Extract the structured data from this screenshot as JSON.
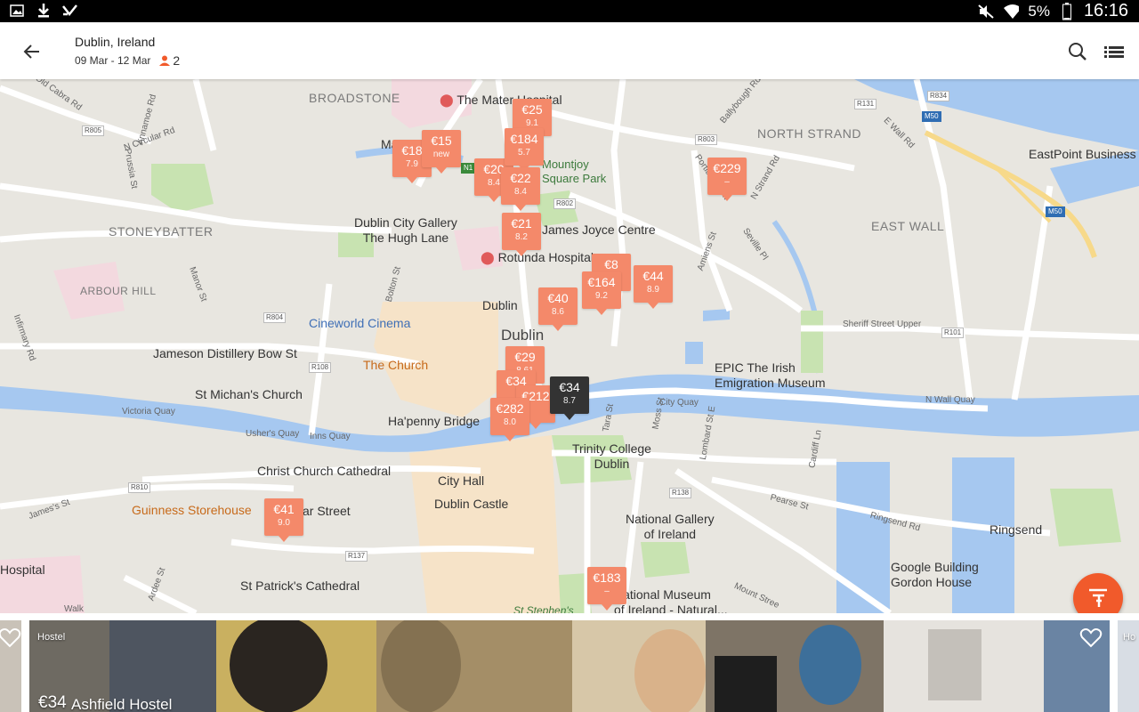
{
  "status": {
    "battery": "5%",
    "time": "16:16"
  },
  "header": {
    "city": "Dublin, Ireland",
    "dates": "09 Mar - 12 Mar",
    "guests": "2"
  },
  "map": {
    "labels": {
      "broadstone": "BROADSTONE",
      "north_strand": "NORTH STRAND",
      "stoneybatter": "STONEYBATTER",
      "east_wall": "EAST WALL",
      "arbour_hill": "ARBOUR HILL",
      "mater_hospital": "The Mater Hospital",
      "mater": "Mater",
      "mountjoy": "Mountjoy\nSquare Park",
      "gallery": "Dublin City Gallery\nThe Hugh Lane",
      "joyce": "James Joyce Centre",
      "rotunda": "Rotunda Hospital",
      "dublin_small": "Dublin",
      "dublin_big": "Dublin",
      "cineworld": "Cineworld Cinema",
      "jameson": "Jameson Distillery Bow St",
      "the_church": "The Church",
      "st_michans": "St Michan's Church",
      "hapenny": "Ha'penny Bridge",
      "epic": "EPIC The Irish\nEmigration Museum",
      "trinity": "Trinity College\nDublin",
      "christ_church": "Christ Church Cathedral",
      "city_hall": "City Hall",
      "dublin_castle": "Dublin Castle",
      "guinness": "Guinness Storehouse",
      "thomas_st": "ar Street",
      "national_gallery": "National Gallery\nof Ireland",
      "st_patricks": "St Patrick's Cathedral",
      "nat_museum": "National Museum\nof Ireland - Natural...",
      "st_stephens": "St Stephen's",
      "google": "Google Building\nGordon House",
      "ringsend": "Ringsend",
      "eastpoint": "EastPoint Business",
      "hospital": "Hospital",
      "sheriff": "Sheriff Street Upper",
      "north_wall": "N Wall Quay",
      "city_quay": "City Quay",
      "victoria_quay": "Victoria Quay",
      "ushers_quay": "Usher's Quay",
      "inns_quay": "Inns Quay",
      "old_cabra": "Old Cabra Rd",
      "n_circular": "N Circular Rd",
      "ballybough": "Ballybough Rd",
      "portland": "Portland Row",
      "n_strand_rd": "N Strand Rd",
      "amiens": "Amiens St",
      "seville": "Seville Pl",
      "e_wall_rd": "E Wall Rd",
      "bolton": "Bolton St",
      "manor": "Manor St",
      "infirmary": "Infirmary Rd",
      "prussia": "Prussia St",
      "annamoe": "Annamoe Rd",
      "tara": "Tara St",
      "moss": "Moss St",
      "lombard": "Lombard St E",
      "cardiff": "Cardiff Ln",
      "pearse": "Pearse St",
      "ringsend_rd": "Ringsend Rd",
      "mount_st": "Mount Stree",
      "james_st": "James's St",
      "cork_st": "Walk",
      "ardee": "Ardee St",
      "r_805": "R805",
      "r_803": "R803",
      "r_131": "R131",
      "r_834": "R834",
      "r_802": "R802",
      "r_804": "R804",
      "r_108": "R108",
      "r_101": "R101",
      "r_810": "R810",
      "r_138": "R138",
      "r_137": "R137",
      "m_50a": "M50",
      "m_50b": "M50",
      "n_1": "N1"
    },
    "pins": [
      {
        "price": "€25",
        "rating": "9.1"
      },
      {
        "price": "€18",
        "rating": "7.9"
      },
      {
        "price": "€15",
        "rating": "new"
      },
      {
        "price": "€184",
        "rating": "5.7"
      },
      {
        "price": "€20",
        "rating": "8.4"
      },
      {
        "price": "€22",
        "rating": "8.4"
      },
      {
        "price": "€229",
        "rating": "–"
      },
      {
        "price": "€21",
        "rating": "8.2"
      },
      {
        "price": "€8",
        "rating": ""
      },
      {
        "price": "€164",
        "rating": "9.2"
      },
      {
        "price": "€44",
        "rating": "8.9"
      },
      {
        "price": "€40",
        "rating": "8.6"
      },
      {
        "price": "€29",
        "rating": "8.61"
      },
      {
        "price": "€34",
        "rating": ""
      },
      {
        "price": "€212",
        "rating": ""
      },
      {
        "price": "€282",
        "rating": "8.0"
      },
      {
        "price": "€34",
        "rating": "8.7"
      },
      {
        "price": "€41",
        "rating": "9.0"
      },
      {
        "price": "€183",
        "rating": "–"
      }
    ]
  },
  "cards": [
    {
      "type": "Hostel",
      "price": "€34",
      "name": "Ashfield Hostel"
    },
    {
      "type": "Ho"
    }
  ],
  "colors": {
    "accent": "#f15a2b",
    "pin": "#f4896a",
    "selected_pin": "#333333",
    "water": "#a6c8f0"
  }
}
